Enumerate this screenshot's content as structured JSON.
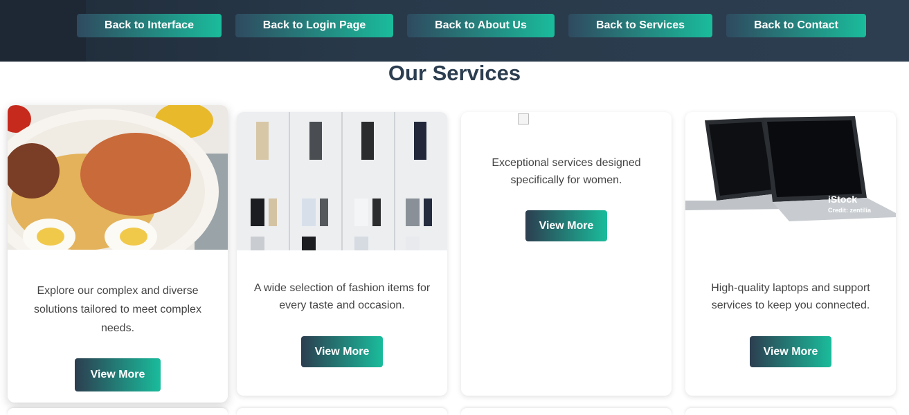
{
  "nav": {
    "buttons": [
      "Back to Interface",
      "Back to Login Page",
      "Back to About Us",
      "Back to Services",
      "Back to Contact"
    ]
  },
  "page": {
    "title": "Our Services"
  },
  "cards": [
    {
      "image": "food-plate-image",
      "description": "Explore our complex and diverse solutions tailored to meet complex needs.",
      "button": "View More"
    },
    {
      "image": "fashion-clothing-image",
      "description": "A wide selection of fashion items for every taste and occasion.",
      "button": "View More"
    },
    {
      "image": "broken-image",
      "description": "Exceptional services designed specifically for women.",
      "button": "View More"
    },
    {
      "image": "laptops-image",
      "watermark": "iStock",
      "watermark_credit": "Credit: zentilia",
      "description": "High-quality laptops and support services to keep you connected.",
      "button": "View More"
    }
  ],
  "colors": {
    "header_bg": "#2c3e50",
    "accent": "#1abc9c",
    "title": "#2c3e50"
  }
}
